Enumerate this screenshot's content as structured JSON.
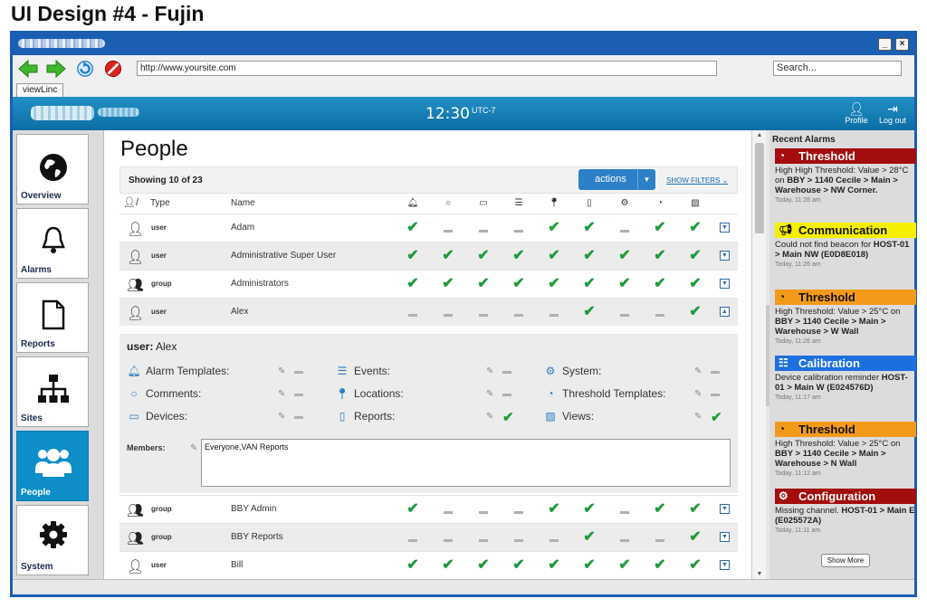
{
  "page_title": "UI Design #4 - Fujin",
  "browser": {
    "url": "http://www.yoursite.com",
    "search_placeholder": "Search...",
    "tab_label": "viewLinc"
  },
  "header": {
    "time": "12:30",
    "timezone": "UTC-7",
    "profile_label": "Profile",
    "logout_label": "Log out"
  },
  "sidebar": {
    "items": [
      {
        "label": "Overview",
        "icon": "globe-icon"
      },
      {
        "label": "Alarms",
        "icon": "bell-icon"
      },
      {
        "label": "Reports",
        "icon": "document-icon"
      },
      {
        "label": "Sites",
        "icon": "sitemap-icon"
      },
      {
        "label": "People",
        "icon": "people-icon",
        "active": true
      },
      {
        "label": "System",
        "icon": "gear-icon"
      }
    ]
  },
  "main": {
    "title": "People",
    "showing": "Showing 10 of 23",
    "actions_label": "actions",
    "show_filters": "SHOW FILTERS",
    "columns": {
      "type": "Type",
      "name": "Name"
    },
    "permission_columns": [
      "alarm-templates",
      "comments",
      "devices",
      "events",
      "locations",
      "reports",
      "system",
      "threshold-templates",
      "views"
    ],
    "rows": [
      {
        "type": "user",
        "name": "Adam",
        "perms": [
          1,
          0,
          0,
          0,
          1,
          1,
          0,
          1,
          1
        ]
      },
      {
        "type": "user",
        "name": "Administrative Super User",
        "perms": [
          1,
          1,
          1,
          1,
          1,
          1,
          1,
          1,
          1
        ]
      },
      {
        "type": "group",
        "name": "Administrators",
        "perms": [
          1,
          1,
          1,
          1,
          1,
          1,
          1,
          1,
          1
        ]
      },
      {
        "type": "user",
        "name": "Alex",
        "perms": [
          0,
          0,
          0,
          0,
          0,
          1,
          0,
          0,
          1
        ],
        "expanded": true
      },
      {
        "type": "group",
        "name": "BBY Admin",
        "perms": [
          1,
          0,
          0,
          0,
          1,
          1,
          0,
          1,
          1
        ]
      },
      {
        "type": "group",
        "name": "BBY Reports",
        "perms": [
          0,
          0,
          0,
          0,
          0,
          1,
          0,
          0,
          1
        ]
      },
      {
        "type": "user",
        "name": "Bill",
        "perms": [
          1,
          1,
          1,
          1,
          1,
          1,
          1,
          1,
          1
        ]
      }
    ],
    "detail": {
      "prefix": "user:",
      "name": "Alex",
      "permissions": [
        {
          "label": "Alarm Templates:",
          "value": false
        },
        {
          "label": "Comments:",
          "value": false
        },
        {
          "label": "Devices:",
          "value": false
        },
        {
          "label": "Events:",
          "value": false
        },
        {
          "label": "Locations:",
          "value": false
        },
        {
          "label": "Reports:",
          "value": true
        },
        {
          "label": "System:",
          "value": false
        },
        {
          "label": "Threshold Templates:",
          "value": false
        },
        {
          "label": "Views:",
          "value": true
        }
      ],
      "members_label": "Members:",
      "members_value": "Everyone,VAN Reports"
    }
  },
  "alarms": {
    "title": "Recent Alarms",
    "items": [
      {
        "category": "Threshold",
        "color": "#a30d0d",
        "text_color": "#ffffff",
        "icon": "gauge-icon",
        "lead": "High High Threshold: Value > 28°C on ",
        "path": "BBY > 1140 Cecile > Main > Warehouse > NW Corner.",
        "when": "Today, 11:28 am"
      },
      {
        "category": "Communication",
        "color": "#f6f000",
        "text_color": "#111111",
        "icon": "megaphone-icon",
        "lead": "Could not find beacon for ",
        "path": "HOST-01 > Main NW (E0D8E018)",
        "when": "Today, 11:26 am"
      },
      {
        "category": "Threshold",
        "color": "#f39a1b",
        "text_color": "#111111",
        "icon": "gauge-icon",
        "lead": "High Threshold: Value > 25°C on ",
        "path": "BBY > 1140 Cecile > Main > Warehouse > W Wall",
        "when": "Today, 11:26 am"
      },
      {
        "category": "Calibration",
        "color": "#1c6fe0",
        "text_color": "#ffffff",
        "icon": "sliders-icon",
        "lead": "Device calibration reminder ",
        "path": "HOST-01 > Main W (E024576D)",
        "when": "Today, 11:17 am"
      },
      {
        "category": "Threshold",
        "color": "#f39a1b",
        "text_color": "#111111",
        "icon": "gauge-icon",
        "lead": "High Threshold: Value > 25°C on ",
        "path": "BBY > 1140 Cecile > Main > Warehouse > N Wall",
        "when": "Today, 11:12 am"
      },
      {
        "category": "Configuration",
        "color": "#a30d0d",
        "text_color": "#ffffff",
        "icon": "gear-icon",
        "lead": "Missing channel. ",
        "path": "HOST-01 > Main E (E025572A)",
        "when": "Today, 11:11 am"
      }
    ],
    "show_more": "Show More"
  }
}
